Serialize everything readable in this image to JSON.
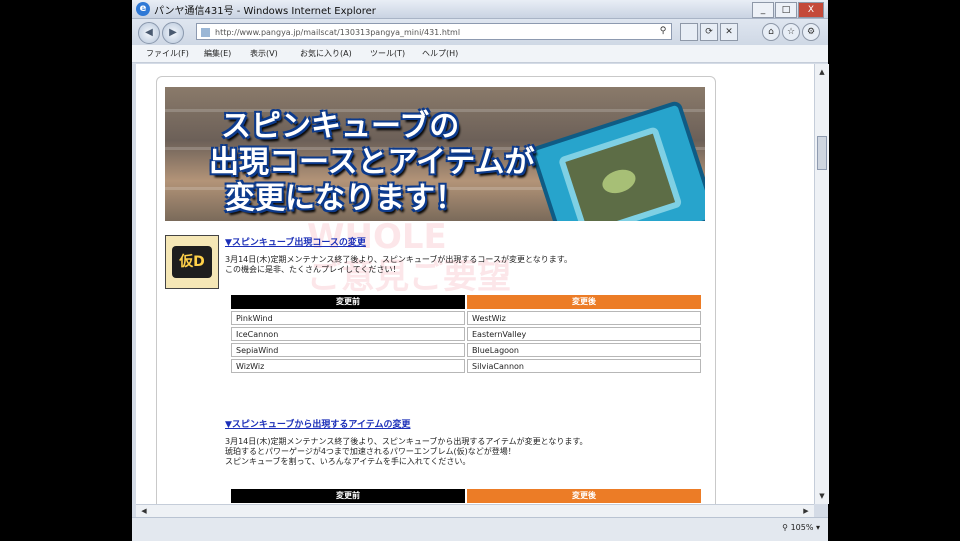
{
  "window": {
    "title": "パンヤ通信431号 - Windows Internet Explorer",
    "controls": {
      "minimize": "_",
      "maximize": "□",
      "close": "X"
    }
  },
  "toolbar": {
    "back": "◀",
    "forward": "▶",
    "address": "http://www.pangya.jp/mailscat/130313pangya_mini/431.html",
    "search_icon": "⚲",
    "refresh": "⟳",
    "stop": "✕"
  },
  "menu": {
    "items": [
      "ファイル(F)",
      "編集(E)",
      "表示(V)",
      "お気に入り(A)",
      "ツール(T)",
      "ヘルプ(H)"
    ]
  },
  "banner": {
    "lines": [
      "スピンキューブの",
      "出現コースとアイテムが",
      "変更になります！"
    ]
  },
  "badge": {
    "text": "仮D"
  },
  "section1": {
    "title": "▼スピンキューブ出現コースの変更",
    "body": [
      "3月14日(木)定期メンテナンス終了後より、スピンキューブが出現するコースが変更となります。",
      "この機会に是非、たくさんプレイしてください！"
    ],
    "before_header": "変更前",
    "after_header": "変更後",
    "before": [
      "PinkWind",
      "IceCannon",
      "SepiaWind",
      "WizWiz"
    ],
    "after": [
      "WestWiz",
      "EasternValley",
      "BlueLagoon",
      "SilviaCannon"
    ]
  },
  "section2": {
    "title": "▼スピンキューブから出現するアイテムの変更",
    "body": [
      "3月14日(木)定期メンテナンス終了後より、スピンキューブから出現するアイテムが変更となります。",
      "琥珀するとパワーゲージが4つまで加速されるパワーエンブレム(仮)などが登場！",
      "スピンキューブを割って、いろんなアイテムを手に入れてください。"
    ],
    "before_header": "変更前",
    "after_header": "変更後"
  },
  "watermark": {
    "lines": [
      "WHOLE",
      "ご意見ご要望"
    ]
  },
  "status": {
    "zoom": "105%"
  },
  "colors": {
    "before_header": "#000000",
    "after_header": "#ec7c26",
    "link": "#1b2fb8"
  }
}
